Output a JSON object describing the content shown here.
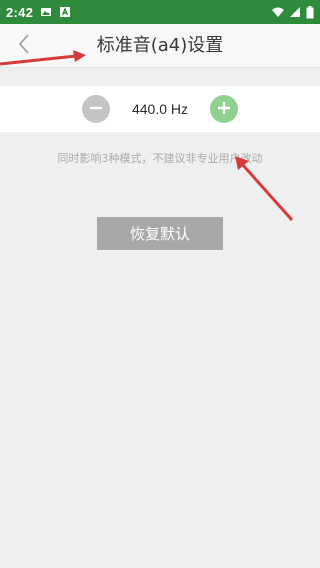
{
  "status_bar": {
    "time": "2:42",
    "left_icons": [
      "image-icon",
      "text-a-icon"
    ],
    "right_icons": [
      "wifi-icon",
      "signal-icon",
      "battery-icon"
    ],
    "background": "#2e8b3c"
  },
  "app_bar": {
    "title": "标准音(a4)设置",
    "back_icon": "chevron-left-icon"
  },
  "frequency": {
    "value": "440.0 Hz",
    "decrease_icon": "minus-circle-icon",
    "increase_icon": "plus-circle-icon",
    "decrease_color": "#c4c4c4",
    "increase_color": "#8fd18f"
  },
  "hint": "同时影响3种模式，不建议非专业用户改动",
  "reset_button_label": "恢复默认",
  "annotations": {
    "arrow_color": "#d63b3b"
  }
}
